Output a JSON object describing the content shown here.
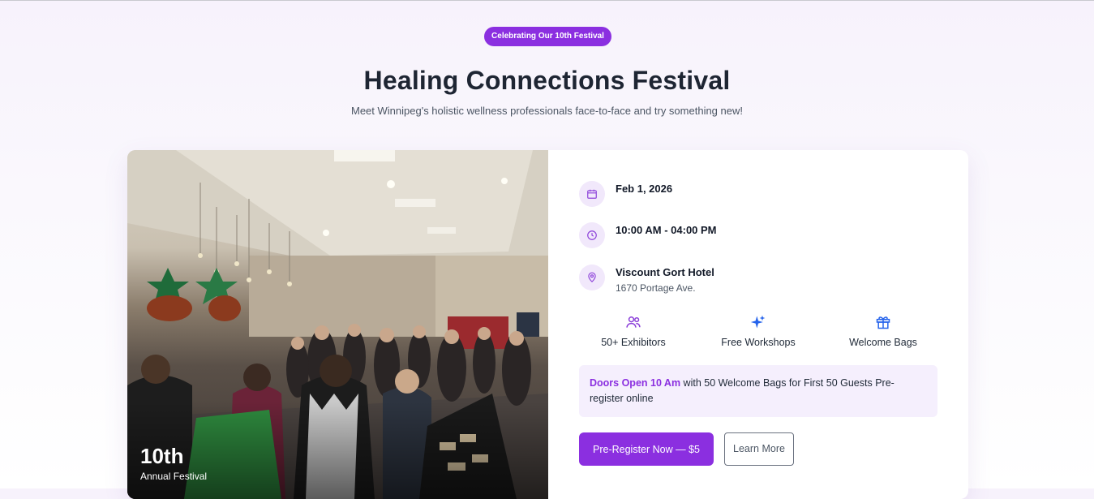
{
  "hero": {
    "badge": "Celebrating Our 10th Festival",
    "title": "Healing Connections Festival",
    "subtitle": "Meet Winnipeg's holistic wellness professionals face-to-face and try something new!"
  },
  "photo": {
    "big_text": "10th",
    "small_text": "Annual Festival"
  },
  "details": {
    "date": {
      "icon": "calendar-icon",
      "text": "Feb 1, 2026"
    },
    "time": {
      "icon": "clock-icon",
      "text": "10:00 AM - 04:00 PM"
    },
    "location": {
      "icon": "map-pin-icon",
      "name": "Viscount Gort Hotel",
      "address": "1670 Portage Ave."
    }
  },
  "features": [
    {
      "icon": "users-icon",
      "label": "50+ Exhibitors"
    },
    {
      "icon": "sparkles-icon",
      "label": "Free Workshops"
    },
    {
      "icon": "gift-icon",
      "label": "Welcome Bags"
    }
  ],
  "notice": {
    "highlight": "Doors Open 10 Am",
    "text": " with 50 Welcome Bags for First 50 Guests Pre-register online"
  },
  "actions": {
    "primary": "Pre-Register Now — $5",
    "secondary": "Learn More"
  },
  "colors": {
    "accent": "#8b2fe0",
    "icon_purple": "#8b3fd9",
    "icon_blue": "#2563eb",
    "notice_bg": "#f5effd",
    "icon_circle_bg": "#f1e8fb"
  }
}
